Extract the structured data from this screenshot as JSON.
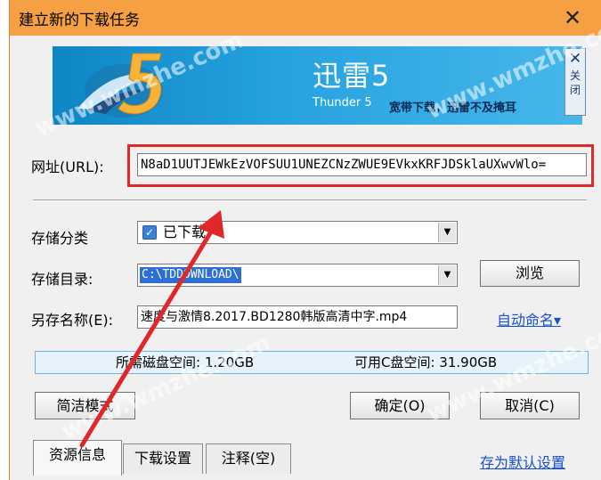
{
  "window": {
    "title": "建立新的下载任务",
    "close_glyph": "✕"
  },
  "banner": {
    "brand": "迅雷5",
    "sub": "Thunder 5",
    "slogan": "宽带下载，迅雷不及掩耳",
    "close_glyph": "✕",
    "close_label_1": "关",
    "close_label_2": "闭"
  },
  "url": {
    "label": "网址(URL):",
    "value": "N8aD1UUTJEWkEzVOFSUU1UNEZCNzZWUE9EVkxKRFJDSklaUXwvWlo="
  },
  "category": {
    "label": "存储分类",
    "value": "已下载",
    "check_glyph": "✓"
  },
  "directory": {
    "label": "存储目录:",
    "value": "C:\\TDDOWNLOAD\\",
    "browse_label": "浏览"
  },
  "saveas": {
    "label": "另存名称(E):",
    "value": "速度与激情8.2017.BD1280韩版高清中字.mp4",
    "auto_name": "自动命名▾"
  },
  "disk": {
    "required": "所需磁盘空间: 1.20GB",
    "free": "可用C盘空间: 31.90GB"
  },
  "buttons": {
    "simple_mode": "简洁模式",
    "ok": "确定(O)",
    "cancel": "取消(C)"
  },
  "tabs": [
    {
      "label": "资源信息"
    },
    {
      "label": "下载设置"
    },
    {
      "label": "注释(空)"
    }
  ],
  "save_default": "存为默认设置",
  "watermark_text": "www.wmzhe.com",
  "colors": {
    "titlebar": "#f4a043",
    "highlight_box": "#e0272a",
    "arrow": "#e0272a",
    "link": "#1a4fd0",
    "selection": "#2e6fd4"
  },
  "icons": {
    "title_close": "close-icon",
    "banner_close": "close-icon",
    "dropdown": "chevron-down-icon",
    "checkbox": "check-icon",
    "auto_name": "caret-down-icon"
  }
}
